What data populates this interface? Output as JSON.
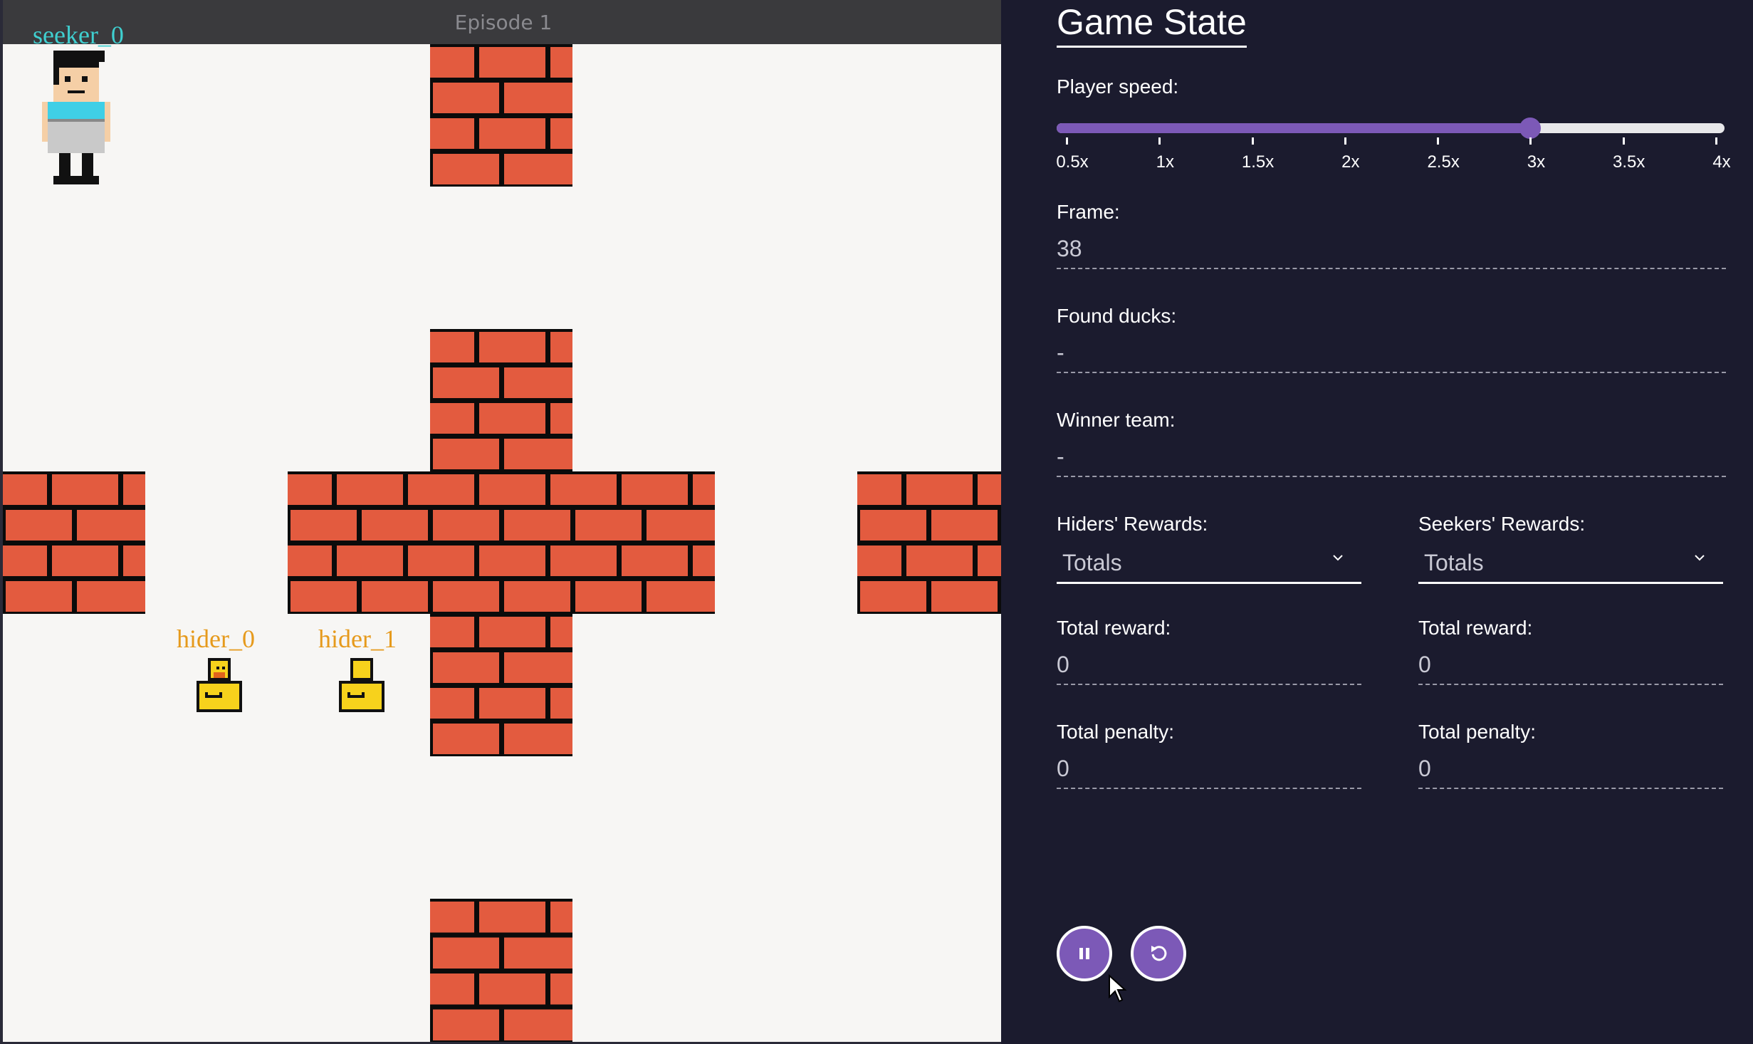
{
  "game": {
    "episode_label": "Episode 1",
    "agents": [
      {
        "id": "seeker_0",
        "label": "seeker_0",
        "color": "#3fcfd0",
        "type": "seeker"
      },
      {
        "id": "hider_0",
        "label": "hider_0",
        "color": "#e69a1c",
        "type": "duck"
      },
      {
        "id": "hider_1",
        "label": "hider_1",
        "color": "#e69a1c",
        "type": "duck"
      }
    ],
    "wall_color": "#e35b3f",
    "mortar_color": "#0b0b0b"
  },
  "panel": {
    "title": "Game State",
    "player_speed": {
      "label": "Player speed:",
      "ticks": [
        "0.5x",
        "1x",
        "1.5x",
        "2x",
        "2.5x",
        "3x",
        "3.5x",
        "4x"
      ],
      "value": "3x",
      "accent": "#7c59b7"
    },
    "frame": {
      "label": "Frame:",
      "value": "38"
    },
    "found_ducks": {
      "label": "Found ducks:",
      "value": "-"
    },
    "winner_team": {
      "label": "Winner team:",
      "value": "-"
    },
    "hiders": {
      "rewards_label": "Hiders' Rewards:",
      "select_value": "Totals",
      "total_reward_label": "Total reward:",
      "total_reward": "0",
      "total_penalty_label": "Total penalty:",
      "total_penalty": "0"
    },
    "seekers": {
      "rewards_label": "Seekers' Rewards:",
      "select_value": "Totals",
      "total_reward_label": "Total reward:",
      "total_reward": "0",
      "total_penalty_label": "Total penalty:",
      "total_penalty": "0"
    },
    "controls": {
      "pause_icon": "pause-icon",
      "restart_icon": "restart-icon"
    }
  }
}
